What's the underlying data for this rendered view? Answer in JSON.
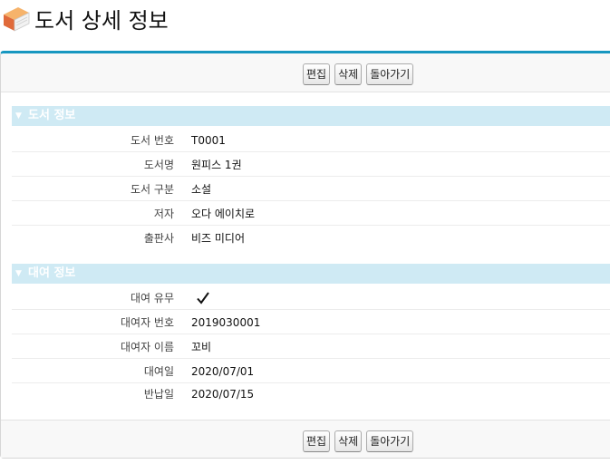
{
  "header": {
    "title": "도서 상세 정보",
    "icon": "book-icon"
  },
  "toolbar": {
    "edit_label": "편집",
    "delete_label": "삭제",
    "back_label": "돌아가기"
  },
  "book_section": {
    "title": "도서 정보",
    "fields": [
      {
        "label": "도서 번호",
        "value": "T0001"
      },
      {
        "label": "도서명",
        "value": "원피스 1권"
      },
      {
        "label": "도서 구분",
        "value": "소설"
      },
      {
        "label": "저자",
        "value": "오다 에이치로"
      },
      {
        "label": "출판사",
        "value": "비즈 미디어"
      }
    ]
  },
  "loan_section": {
    "title": "대여 정보",
    "loaned_label": "대여 유무",
    "loaned": true,
    "fields": [
      {
        "label": "대여자 번호",
        "value": "2019030001"
      },
      {
        "label": "대여자 이름",
        "value": "꼬비"
      },
      {
        "label": "대여일",
        "value": "2020/07/01"
      },
      {
        "label": "반납일",
        "value": "2020/07/15"
      }
    ]
  },
  "colors": {
    "accent": "#1797c0",
    "section_bg": "#cfeaf4"
  }
}
